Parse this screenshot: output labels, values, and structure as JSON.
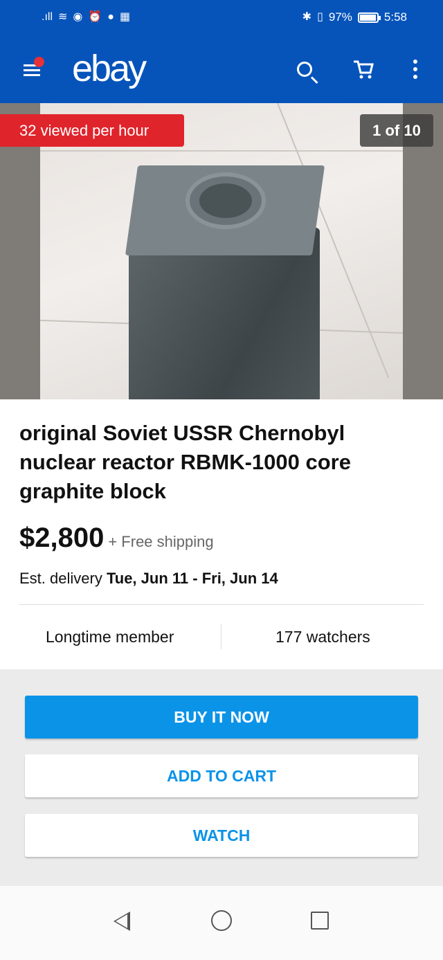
{
  "status_bar": {
    "left_icons": [
      "signal-icon",
      "wifi-icon",
      "eye-icon",
      "alarm-icon",
      "media-icon",
      "activity-icon"
    ],
    "battery_percent_text": "97%",
    "battery_level": 0.97,
    "time": "5:58",
    "right_icons": [
      "bluetooth-icon",
      "vibrate-icon"
    ]
  },
  "header": {
    "logo_text": "ebay",
    "icons": [
      "menu-icon",
      "search-icon",
      "cart-icon",
      "more-icon"
    ],
    "brand_color": "#0654ba",
    "notification_dot_color": "#e53238"
  },
  "gallery": {
    "viewed_badge": "32 viewed per hour",
    "image_counter": "1 of 10"
  },
  "listing": {
    "title": "original Soviet USSR Chernobyl nuclear reactor RBMK-1000 core graphite block",
    "price": "$2,800",
    "shipping": "+ Free shipping",
    "delivery_label": "Est. delivery",
    "delivery_dates": "Tue, Jun 11 - Fri, Jun 14",
    "seller_stat": "Longtime member",
    "watchers": "177 watchers"
  },
  "actions": {
    "buy_now": "BUY IT NOW",
    "add_to_cart": "ADD TO CART",
    "watch": "WATCH",
    "accent_color": "#0b93e8"
  },
  "nav_bar": {
    "icons": [
      "back-icon",
      "home-icon",
      "recents-icon"
    ]
  }
}
